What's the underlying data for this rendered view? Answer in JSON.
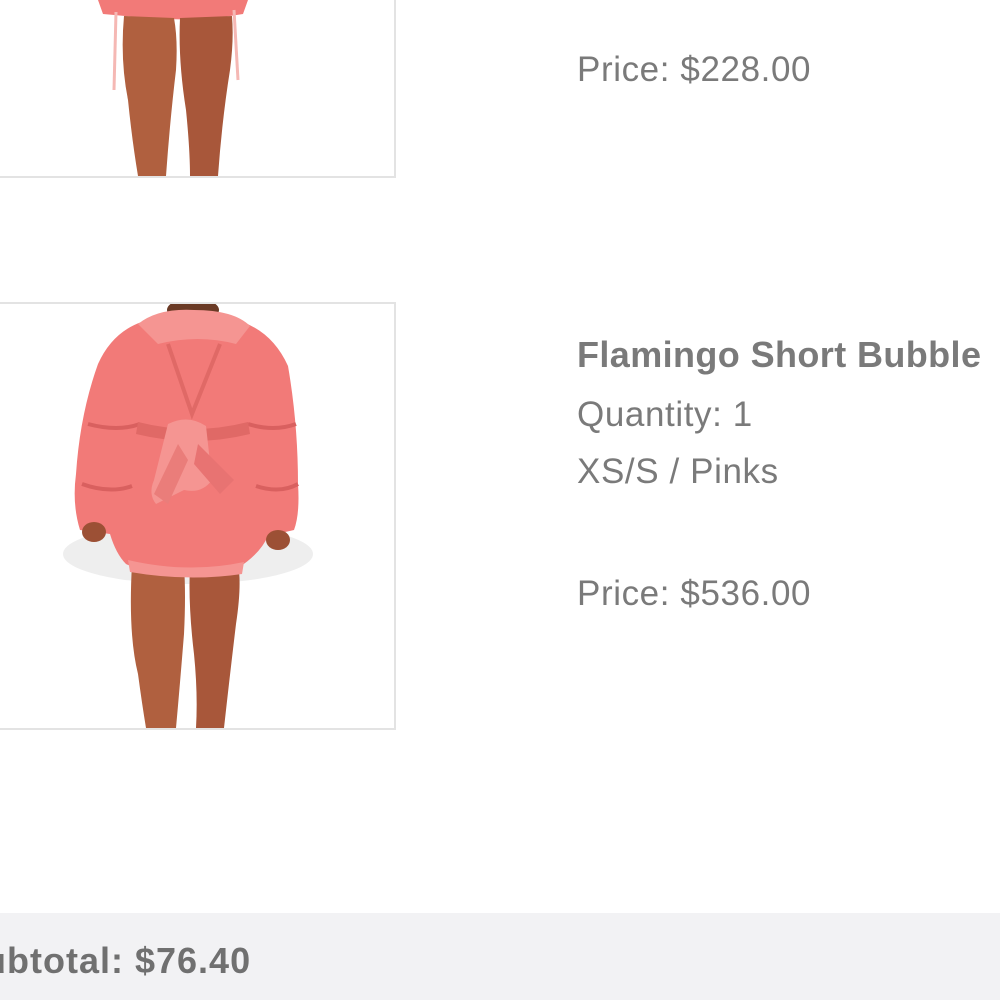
{
  "items": [
    {
      "price_label": "Price:",
      "price": "$228.00",
      "image_icon": "pink-puffer-jacket-photo"
    },
    {
      "name": "Flamingo Short Bubble",
      "quantity": "Quantity: 1",
      "variant": "XS/S / Pinks",
      "price_label": "Price:",
      "price": "$536.00",
      "image_icon": "pink-puffer-jacket-photo"
    }
  ],
  "footer": {
    "subtotal_label": "ubtotal:",
    "subtotal_value": "$76.40"
  },
  "colors": {
    "jacket": "#f27a78",
    "jacket_shadow": "#d9605f",
    "skin": "#b0603f",
    "footer_bg": "#f2f2f4",
    "text": "#7a7a7a"
  }
}
